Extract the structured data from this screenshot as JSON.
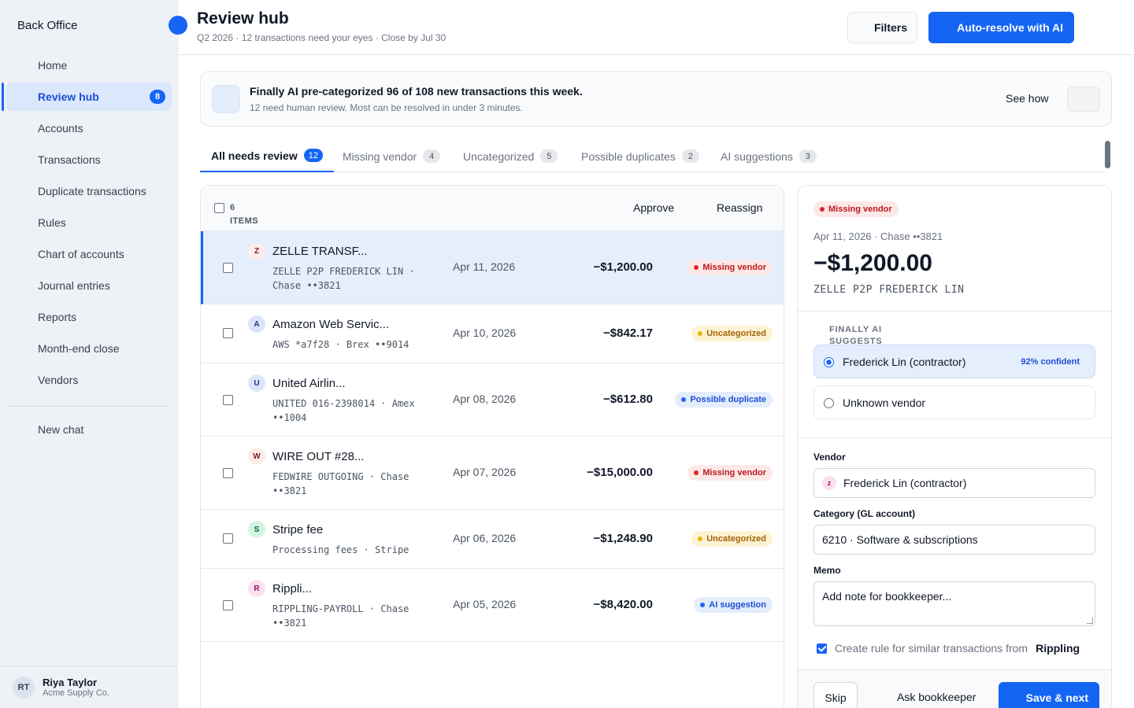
{
  "app": {
    "logo_alt": "Back Office"
  },
  "sidebar": {
    "items": [
      {
        "label": "Home"
      },
      {
        "label": "Review hub",
        "badge": "8"
      },
      {
        "label": "Accounts"
      },
      {
        "label": "Transactions"
      },
      {
        "label": "Duplicate transactions"
      },
      {
        "label": "Rules"
      },
      {
        "label": "Chart of accounts"
      },
      {
        "label": "Journal entries"
      },
      {
        "label": "Reports"
      },
      {
        "label": "Month-end close"
      },
      {
        "label": "Vendors"
      }
    ],
    "new_chat": "New chat",
    "user": {
      "initials": "RT",
      "name": "Riya Taylor",
      "org": "Acme Supply Co."
    }
  },
  "header": {
    "title": "Review hub",
    "subtitle": "Q2 2026 · 12 transactions need your eyes · Close by Jul 30",
    "filters_label": "Filters",
    "auto_resolve_label": "Auto-resolve with AI"
  },
  "banner": {
    "title": "Finally AI pre-categorized 96 of 108 new transactions this week.",
    "subtitle": "12 need human review. Most can be resolved in under 3 minutes.",
    "see_how": "See how"
  },
  "tabs": [
    {
      "label": "All needs review",
      "count": "12"
    },
    {
      "label": "Missing vendor",
      "count": "4"
    },
    {
      "label": "Uncategorized",
      "count": "5"
    },
    {
      "label": "Possible duplicates",
      "count": "2"
    },
    {
      "label": "AI suggestions",
      "count": "3"
    }
  ],
  "list": {
    "count_number": "6",
    "count_unit": "ITEMS",
    "approve_label": "Approve",
    "reassign_label": "Reassign",
    "rows": [
      {
        "initial": "Z",
        "title": "ZELLE TRANSF...",
        "sub": "ZELLE P2P FREDERICK LIN · Chase ••3821",
        "date": "Apr 11, 2026",
        "amount": "−$1,200.00",
        "status": "Missing vendor"
      },
      {
        "initial": "A",
        "title": "Amazon Web Servic...",
        "sub": "AWS *a7f28 · Brex ••9014",
        "date": "Apr 10, 2026",
        "amount": "−$842.17",
        "status": "Uncategorized"
      },
      {
        "initial": "U",
        "title": "United Airlin...",
        "sub": "UNITED 016-2398014 · Amex ••1004",
        "date": "Apr 08, 2026",
        "amount": "−$612.80",
        "status": "Possible duplicate"
      },
      {
        "initial": "W",
        "title": "WIRE OUT #28...",
        "sub": "FEDWIRE OUTGOING · Chase ••3821",
        "date": "Apr 07, 2026",
        "amount": "−$15,000.00",
        "status": "Missing vendor"
      },
      {
        "initial": "S",
        "title": "Stripe fee",
        "sub": "Processing fees · Stripe",
        "date": "Apr 06, 2026",
        "amount": "−$1,248.90",
        "status": "Uncategorized"
      },
      {
        "initial": "R",
        "title": "Rippli...",
        "sub": "RIPPLING-PAYROLL · Chase ••3821",
        "date": "Apr 05, 2026",
        "amount": "−$8,420.00",
        "status": "AI suggestion"
      }
    ]
  },
  "detail": {
    "status": "Missing vendor",
    "meta": "Apr 11, 2026 · Chase ••3821",
    "amount": "−$1,200.00",
    "description": "ZELLE P2P FREDERICK LIN",
    "ai_label": "FINALLY AI SUGGESTS",
    "options": [
      {
        "label": "Frederick Lin (contractor)",
        "confidence": "92% confident"
      },
      {
        "label": "Unknown vendor"
      }
    ],
    "vendor_label": "Vendor",
    "vendor_initial": "z",
    "vendor_value": "Frederick Lin (contractor)",
    "category_label": "Category (GL account)",
    "category_value": "6210 · Software & subscriptions",
    "memo_label": "Memo",
    "memo_placeholder": "Add note for bookkeeper...",
    "rule_text": "Create rule for similar transactions from",
    "rule_vendor": "Rippling",
    "skip_label": "Skip",
    "ask_label": "Ask bookkeeper",
    "save_label": "Save & next"
  },
  "colors": {
    "accent": "#1565f5",
    "missing": "#dc2626",
    "uncategorized": "#eab308",
    "info": "#2563eb"
  }
}
